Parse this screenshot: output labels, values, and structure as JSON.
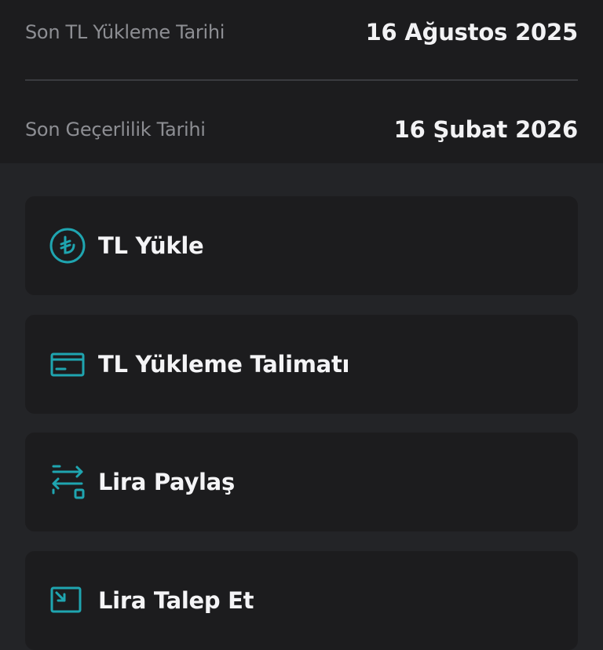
{
  "info": {
    "rows": [
      {
        "label": "Son TL Yükleme Tarihi",
        "value": "16 Ağustos 2025"
      },
      {
        "label": "Son Geçerlilik Tarihi",
        "value": "16 Şubat 2026"
      }
    ]
  },
  "actions": {
    "items": [
      {
        "label": "TL Yükle",
        "icon": "turkish-lira-circle-icon"
      },
      {
        "label": "TL Yükleme Talimatı",
        "icon": "credit-card-icon"
      },
      {
        "label": "Lira Paylaş",
        "icon": "transfer-share-icon"
      },
      {
        "label": "Lira Talep Et",
        "icon": "request-icon"
      }
    ]
  },
  "colors": {
    "accent": "#1fa5b0",
    "card_background": "#1c1c1e",
    "page_background": "#232427",
    "label_gray": "#8d8e93",
    "text_white": "#f2f2f4"
  }
}
